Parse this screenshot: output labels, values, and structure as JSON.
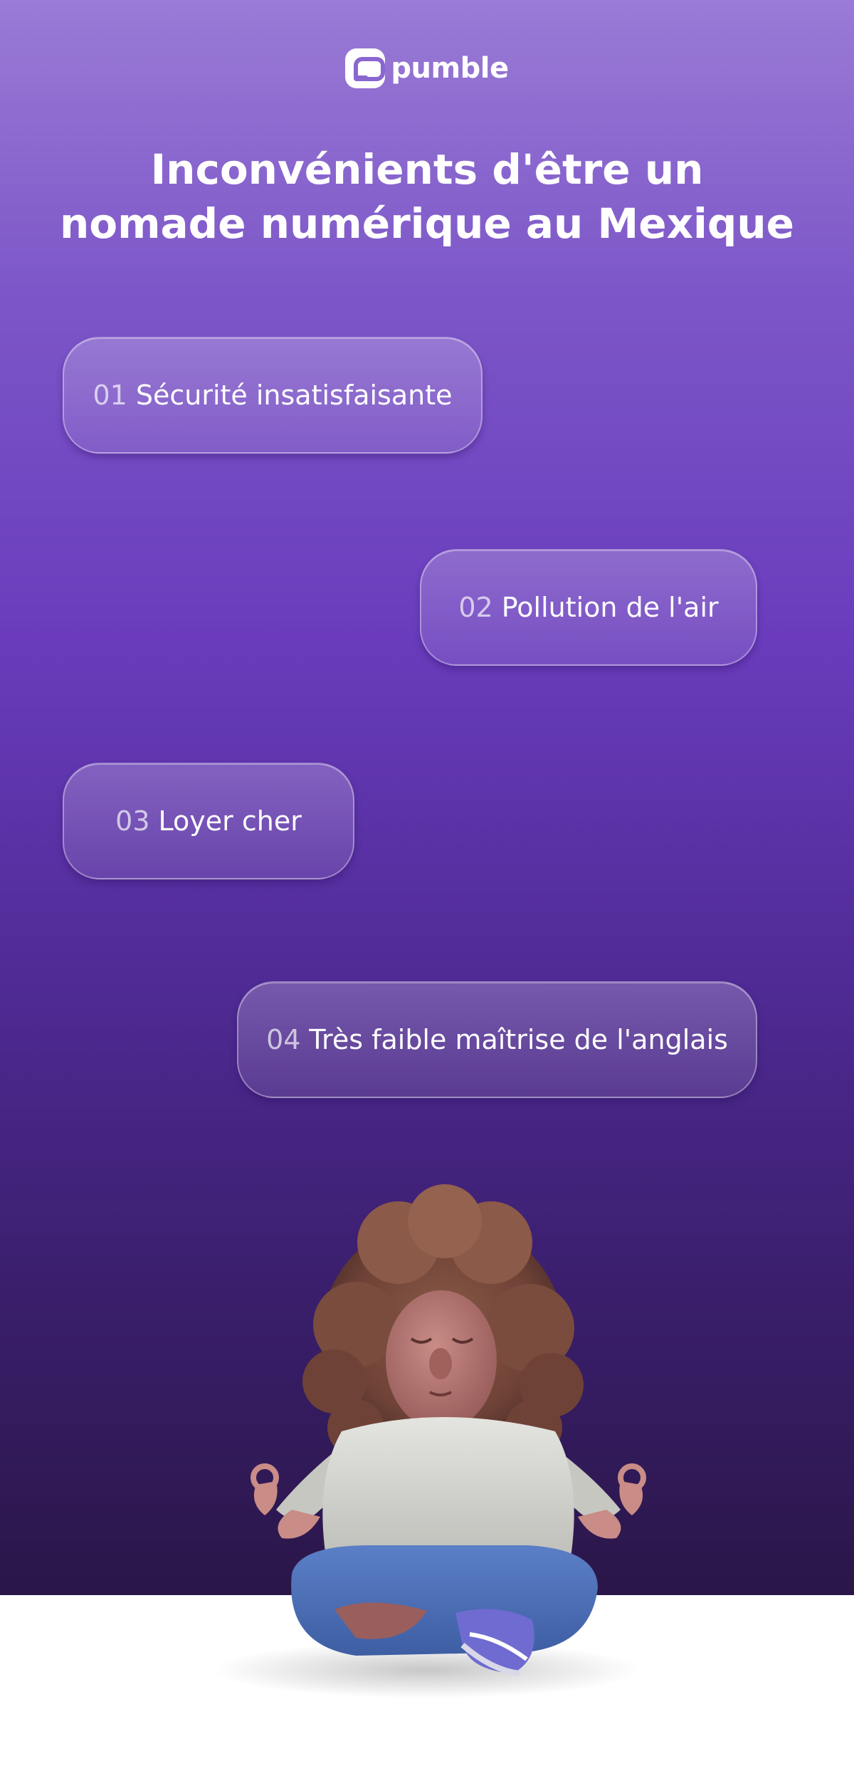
{
  "brand": {
    "name": "pumble",
    "logo_icon": "chat-bubble-icon"
  },
  "title": "Inconvénients d'être un nomade numérique au Mexique",
  "items": [
    {
      "num": "01",
      "label": "Sécurité insatisfaisante"
    },
    {
      "num": "02",
      "label": "Pollution de l'air"
    },
    {
      "num": "03",
      "label": "Loyer cher"
    },
    {
      "num": "04",
      "label": "Très faible maîtrise de l'anglais"
    }
  ],
  "colors": {
    "gradient_top": "#9a7bd6",
    "gradient_mid": "#6a3cbd",
    "gradient_bottom": "#2a1648",
    "text": "#ffffff"
  }
}
